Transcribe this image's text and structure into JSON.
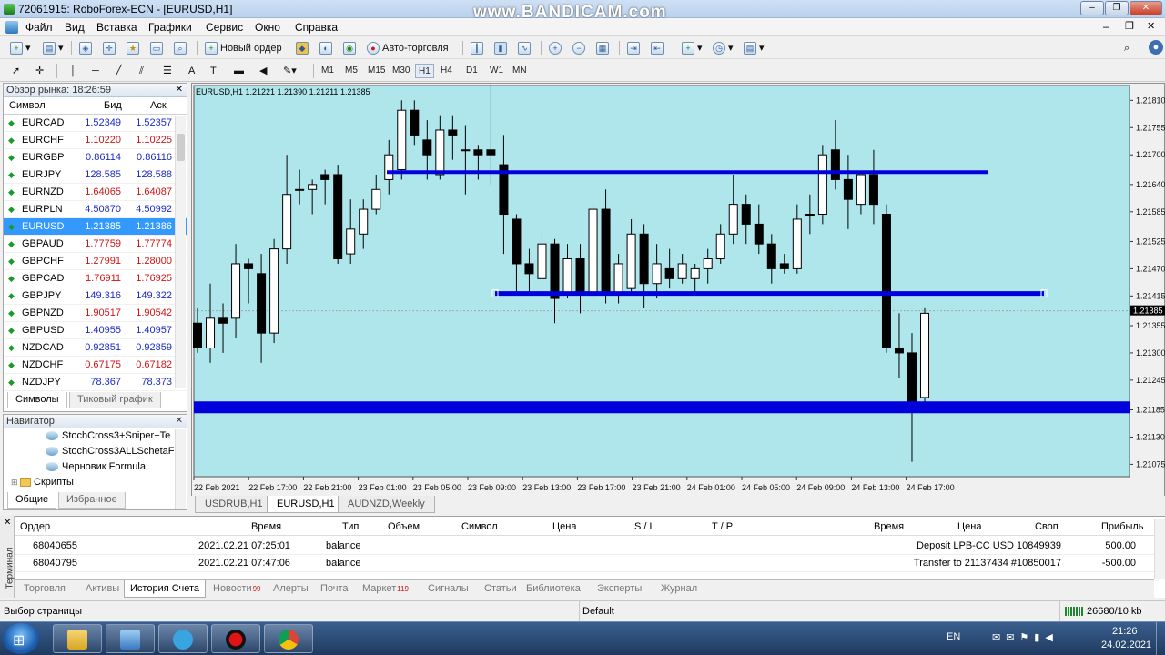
{
  "window": {
    "title": "72061915: RoboForex-ECN - [EURUSD,H1]",
    "watermark": "www.BANDICAM.com"
  },
  "menu": [
    "Файл",
    "Вид",
    "Вставка",
    "Графики",
    "Сервис",
    "Окно",
    "Справка"
  ],
  "toolbar": {
    "new_order": "Новый ордер",
    "autotrading": "Авто-торговля"
  },
  "timeframes": [
    "M1",
    "M5",
    "M15",
    "M30",
    "H1",
    "H4",
    "D1",
    "W1",
    "MN"
  ],
  "active_timeframe": "H1",
  "market_watch": {
    "header": "Обзор рынка: 18:26:59",
    "columns": {
      "symbol": "Символ",
      "bid": "Бид",
      "ask": "Аск"
    },
    "rows": [
      {
        "symbol": "EURCAD",
        "bid": "1.52349",
        "ask": "1.52357",
        "dir": "u"
      },
      {
        "symbol": "EURCHF",
        "bid": "1.10220",
        "ask": "1.10225",
        "dir": "d"
      },
      {
        "symbol": "EURGBP",
        "bid": "0.86114",
        "ask": "0.86116",
        "dir": "u"
      },
      {
        "symbol": "EURJPY",
        "bid": "128.585",
        "ask": "128.588",
        "dir": "u"
      },
      {
        "symbol": "EURNZD",
        "bid": "1.64065",
        "ask": "1.64087",
        "dir": "d"
      },
      {
        "symbol": "EURPLN",
        "bid": "4.50870",
        "ask": "4.50992",
        "dir": "u"
      },
      {
        "symbol": "EURUSD",
        "bid": "1.21385",
        "ask": "1.21386",
        "dir": "u",
        "selected": true
      },
      {
        "symbol": "GBPAUD",
        "bid": "1.77759",
        "ask": "1.77774",
        "dir": "d"
      },
      {
        "symbol": "GBPCHF",
        "bid": "1.27991",
        "ask": "1.28000",
        "dir": "d"
      },
      {
        "symbol": "GBPCAD",
        "bid": "1.76911",
        "ask": "1.76925",
        "dir": "d"
      },
      {
        "symbol": "GBPJPY",
        "bid": "149.316",
        "ask": "149.322",
        "dir": "u"
      },
      {
        "symbol": "GBPNZD",
        "bid": "1.90517",
        "ask": "1.90542",
        "dir": "d"
      },
      {
        "symbol": "GBPUSD",
        "bid": "1.40955",
        "ask": "1.40957",
        "dir": "u"
      },
      {
        "symbol": "NZDCAD",
        "bid": "0.92851",
        "ask": "0.92859",
        "dir": "u"
      },
      {
        "symbol": "NZDCHF",
        "bid": "0.67175",
        "ask": "0.67182",
        "dir": "d"
      },
      {
        "symbol": "NZDJPY",
        "bid": "78.367",
        "ask": "78.373",
        "dir": "u"
      }
    ],
    "tabs": [
      "Символы",
      "Тиковый график"
    ]
  },
  "navigator": {
    "header": "Навигатор",
    "items": [
      "StochCross3+Sniper+Te",
      "StochCross3ALLSchetaF",
      "Черновик Formula",
      "Скрипты"
    ],
    "tabs": [
      "Общие",
      "Избранное"
    ]
  },
  "chart": {
    "info_label": "EURUSD,H1  1.21221 1.21390 1.21211 1.21385",
    "price_labels": [
      "1.21810",
      "1.21755",
      "1.21700",
      "1.21640",
      "1.21585",
      "1.21525",
      "1.21470",
      "1.21415",
      "1.21355",
      "1.21300",
      "1.21245",
      "1.21185",
      "1.21130",
      "1.21075"
    ],
    "current_price": "1.21385",
    "time_labels": [
      "22 Feb 2021",
      "22 Feb 17:00",
      "22 Feb 21:00",
      "23 Feb 01:00",
      "23 Feb 05:00",
      "23 Feb 09:00",
      "23 Feb 13:00",
      "23 Feb 17:00",
      "23 Feb 21:00",
      "24 Feb 01:00",
      "24 Feb 05:00",
      "24 Feb 09:00",
      "24 Feb 13:00",
      "24 Feb 17:00"
    ],
    "bg_color": "#aee6ec",
    "line_color": "#0000dd",
    "levels": [
      1.21665,
      1.2142,
      1.2119
    ],
    "tabs": [
      "USDRUB,H1",
      "EURUSD,H1",
      "AUDNZD,Weekly"
    ],
    "active_tab": "EURUSD,H1"
  },
  "chart_data": {
    "type": "candlestick",
    "ylim": [
      1.2105,
      1.2184
    ],
    "candles": [
      [
        1.2136,
        1.2139,
        1.213,
        1.2131
      ],
      [
        1.2131,
        1.2144,
        1.2128,
        1.2137
      ],
      [
        1.2137,
        1.214,
        1.213,
        1.2136
      ],
      [
        1.2137,
        1.2152,
        1.2133,
        1.2148
      ],
      [
        1.2148,
        1.2149,
        1.214,
        1.2147
      ],
      [
        1.2146,
        1.215,
        1.2128,
        1.2134
      ],
      [
        1.2134,
        1.2153,
        1.2132,
        1.2151
      ],
      [
        1.2151,
        1.217,
        1.2148,
        1.2162
      ],
      [
        1.2163,
        1.2167,
        1.216,
        1.2163
      ],
      [
        1.2163,
        1.2165,
        1.2158,
        1.2164
      ],
      [
        1.2166,
        1.2167,
        1.216,
        1.2165
      ],
      [
        1.2166,
        1.2168,
        1.2148,
        1.2149
      ],
      [
        1.215,
        1.2161,
        1.2148,
        1.2155
      ],
      [
        1.2154,
        1.2161,
        1.2151,
        1.2159
      ],
      [
        1.2159,
        1.2166,
        1.2158,
        1.2163
      ],
      [
        1.2165,
        1.2173,
        1.2162,
        1.217
      ],
      [
        1.2167,
        1.2181,
        1.2165,
        1.2179
      ],
      [
        1.2179,
        1.2181,
        1.2172,
        1.2174
      ],
      [
        1.2173,
        1.2177,
        1.2165,
        1.217
      ],
      [
        1.2166,
        1.2178,
        1.2165,
        1.2175
      ],
      [
        1.2175,
        1.2178,
        1.2169,
        1.2174
      ],
      [
        1.2171,
        1.2176,
        1.2162,
        1.2171
      ],
      [
        1.2171,
        1.2172,
        1.2165,
        1.217
      ],
      [
        1.2171,
        1.2185,
        1.2164,
        1.217
      ],
      [
        1.2168,
        1.2174,
        1.215,
        1.2158
      ],
      [
        1.2157,
        1.2158,
        1.2142,
        1.2148
      ],
      [
        1.2148,
        1.2151,
        1.2142,
        1.2146
      ],
      [
        1.2145,
        1.2155,
        1.2144,
        1.2152
      ],
      [
        1.2152,
        1.2153,
        1.2136,
        1.2141
      ],
      [
        1.2142,
        1.2152,
        1.2141,
        1.2149
      ],
      [
        1.2149,
        1.2152,
        1.2138,
        1.2142
      ],
      [
        1.2142,
        1.216,
        1.2141,
        1.2159
      ],
      [
        1.2159,
        1.2163,
        1.214,
        1.2142
      ],
      [
        1.2142,
        1.215,
        1.214,
        1.2148
      ],
      [
        1.2143,
        1.2157,
        1.2142,
        1.2154
      ],
      [
        1.2154,
        1.2156,
        1.2139,
        1.2144
      ],
      [
        1.2144,
        1.2152,
        1.2141,
        1.2148
      ],
      [
        1.2147,
        1.2151,
        1.2143,
        1.2145
      ],
      [
        1.2145,
        1.215,
        1.2144,
        1.2148
      ],
      [
        1.2145,
        1.2148,
        1.2142,
        1.2147
      ],
      [
        1.2147,
        1.2151,
        1.2144,
        1.2149
      ],
      [
        1.2149,
        1.2156,
        1.2148,
        1.2154
      ],
      [
        1.2154,
        1.2166,
        1.2152,
        1.216
      ],
      [
        1.216,
        1.2162,
        1.2152,
        1.2156
      ],
      [
        1.2156,
        1.216,
        1.215,
        1.2152
      ],
      [
        1.2152,
        1.2154,
        1.2144,
        1.2147
      ],
      [
        1.2148,
        1.215,
        1.2146,
        1.2147
      ],
      [
        1.2147,
        1.216,
        1.2146,
        1.2157
      ],
      [
        1.2158,
        1.2162,
        1.2154,
        1.2158
      ],
      [
        1.2158,
        1.2172,
        1.2156,
        1.217
      ],
      [
        1.2171,
        1.2177,
        1.2163,
        1.2165
      ],
      [
        1.2165,
        1.217,
        1.2155,
        1.2161
      ],
      [
        1.216,
        1.2166,
        1.2158,
        1.2166
      ],
      [
        1.2166,
        1.2171,
        1.2156,
        1.216
      ],
      [
        1.2158,
        1.216,
        1.213,
        1.2131
      ],
      [
        1.2131,
        1.2138,
        1.2125,
        1.213
      ],
      [
        1.213,
        1.2134,
        1.2108,
        1.2119
      ],
      [
        1.2121,
        1.2139,
        1.212,
        1.2138
      ]
    ]
  },
  "terminal": {
    "columns": [
      "Ордер",
      "Время",
      "Тип",
      "Объем",
      "Символ",
      "Цена",
      "S / L",
      "T / P",
      "Время",
      "Цена",
      "Своп",
      "Прибыль"
    ],
    "rows": [
      {
        "order": "68040655",
        "time": "2021.02.21 07:25:01",
        "type": "balance",
        "comment": "Deposit LPB-CC USD 10849939",
        "profit": "500.00"
      },
      {
        "order": "68040795",
        "time": "2021.02.21 07:47:06",
        "type": "balance",
        "comment": "Transfer to 21137434 #10850017",
        "profit": "-500.00"
      }
    ],
    "side_label": "Терминал",
    "tabs": [
      {
        "label": "Торговля"
      },
      {
        "label": "Активы"
      },
      {
        "label": "История Счета",
        "active": true
      },
      {
        "label": "Новости",
        "badge": "99"
      },
      {
        "label": "Алерты"
      },
      {
        "label": "Почта"
      },
      {
        "label": "Маркет",
        "badge": "119"
      },
      {
        "label": "Сигналы"
      },
      {
        "label": "Статьи"
      },
      {
        "label": "Библиотека"
      },
      {
        "label": "Эксперты"
      },
      {
        "label": "Журнал"
      }
    ]
  },
  "status": {
    "hint": "Выбор страницы",
    "profile": "Default",
    "traffic": "26680/10 kb"
  },
  "taskbar": {
    "lang": "EN",
    "time": "21:26",
    "date": "24.02.2021"
  }
}
